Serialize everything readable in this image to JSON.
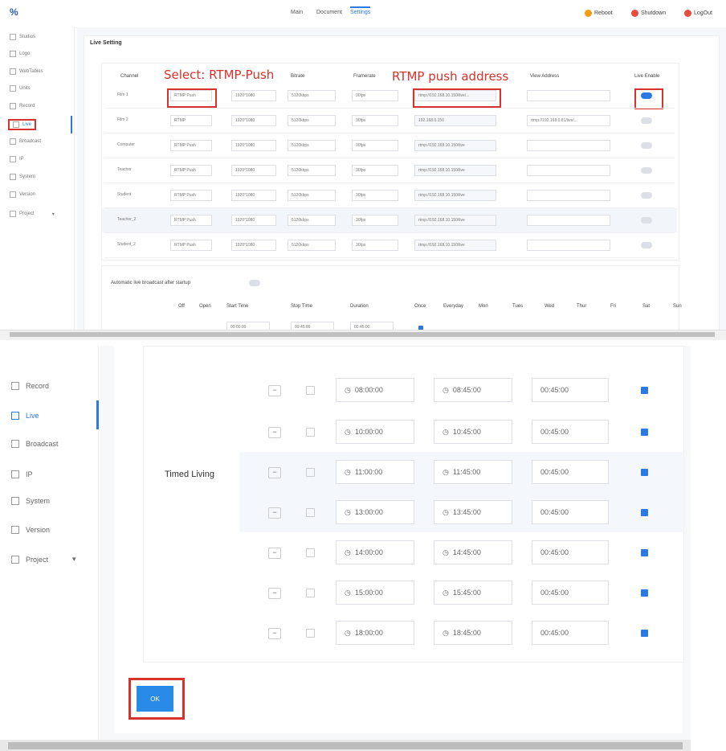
{
  "app": {
    "logo": "%"
  },
  "nav": {
    "tabs": [
      "Main",
      "Document",
      "Settings"
    ],
    "active": "Settings"
  },
  "top_actions": [
    {
      "label": "Reboot",
      "color": "#f39c12"
    },
    {
      "label": "Shutdown",
      "color": "#e74c3c"
    },
    {
      "label": "LogOut",
      "color": "#e74c3c"
    }
  ],
  "sidebar_top": [
    "Studios",
    "Logo",
    "WebTables",
    "Units",
    "Record",
    "Live",
    "Broadcast",
    "IP",
    "System",
    "Version",
    "Project"
  ],
  "sidebar_bottom": [
    "Record",
    "Live",
    "Broadcast",
    "IP",
    "System",
    "Version",
    "Project"
  ],
  "live": {
    "section_title": "Live Setting",
    "headers": [
      "Channel",
      "Select: RTMP-Push",
      "Bitrate",
      "Framerate",
      "RTMP push address",
      "View Address",
      "Live Enable"
    ],
    "rows": [
      {
        "channel": "Film 1",
        "protocol": "RTMP Push",
        "res": "1920*1080",
        "bitrate": "5120kbps",
        "fps": "30fps",
        "push": "rtmp://192.168.10.150/live/...",
        "view": "",
        "enabled": true
      },
      {
        "channel": "Film 2",
        "protocol": "RTMP",
        "res": "1920*1080",
        "bitrate": "5120kbps",
        "fps": "30fps",
        "push": "192.168.0.150",
        "view": "rtmp://192.168.0.81/live/...",
        "enabled": false
      },
      {
        "channel": "Computer",
        "protocol": "RTMP Push",
        "res": "1920*1080",
        "bitrate": "5120kbps",
        "fps": "30fps",
        "push": "rtmp://192.168.10.150/live",
        "view": "",
        "enabled": false
      },
      {
        "channel": "Teacher",
        "protocol": "RTMP Push",
        "res": "1920*1080",
        "bitrate": "5120kbps",
        "fps": "30fps",
        "push": "rtmp://192.168.10.150/live",
        "view": "",
        "enabled": false
      },
      {
        "channel": "Student",
        "protocol": "RTMP Push",
        "res": "1920*1080",
        "bitrate": "5120kbps",
        "fps": "30fps",
        "push": "rtmp://192.168.10.150/live",
        "view": "",
        "enabled": false
      },
      {
        "channel": "Teacher_2",
        "protocol": "RTMP Push",
        "res": "1920*1080",
        "bitrate": "5120kbps",
        "fps": "30fps",
        "push": "rtmp://192.168.10.150/live",
        "view": "",
        "enabled": false
      },
      {
        "channel": "Student_2",
        "protocol": "RTMP Push",
        "res": "1920*1080",
        "bitrate": "5120kbps",
        "fps": "30fps",
        "push": "rtmp://192.168.10.150/live",
        "view": "",
        "enabled": false
      }
    ]
  },
  "auto": {
    "label": "Automatic live broadcast after startup",
    "headers": [
      "Off",
      "Open",
      "Start Time",
      "Stop Time",
      "Duration",
      "Once",
      "Everyday",
      "Mon",
      "Tues",
      "Wed",
      "Thur",
      "Fri",
      "Sat",
      "Sun"
    ],
    "first_row": {
      "start": "09:00:00",
      "stop": "09:45:00",
      "duration": "00:45:00"
    }
  },
  "timed": {
    "label": "Timed Living",
    "rows": [
      {
        "start": "08:00:00",
        "stop": "08:45:00",
        "duration": "00:45:00"
      },
      {
        "start": "10:00:00",
        "stop": "10:45:00",
        "duration": "00:45:00"
      },
      {
        "start": "11:00:00",
        "stop": "11:45:00",
        "duration": "00:45:00"
      },
      {
        "start": "13:00:00",
        "stop": "13:45:00",
        "duration": "00:45:00"
      },
      {
        "start": "14:00:00",
        "stop": "14:45:00",
        "duration": "00:45:00"
      },
      {
        "start": "15:00:00",
        "stop": "15:45:00",
        "duration": "00:45:00"
      },
      {
        "start": "18:00:00",
        "stop": "18:45:00",
        "duration": "00:45:00"
      }
    ]
  },
  "ok_label": "OK"
}
